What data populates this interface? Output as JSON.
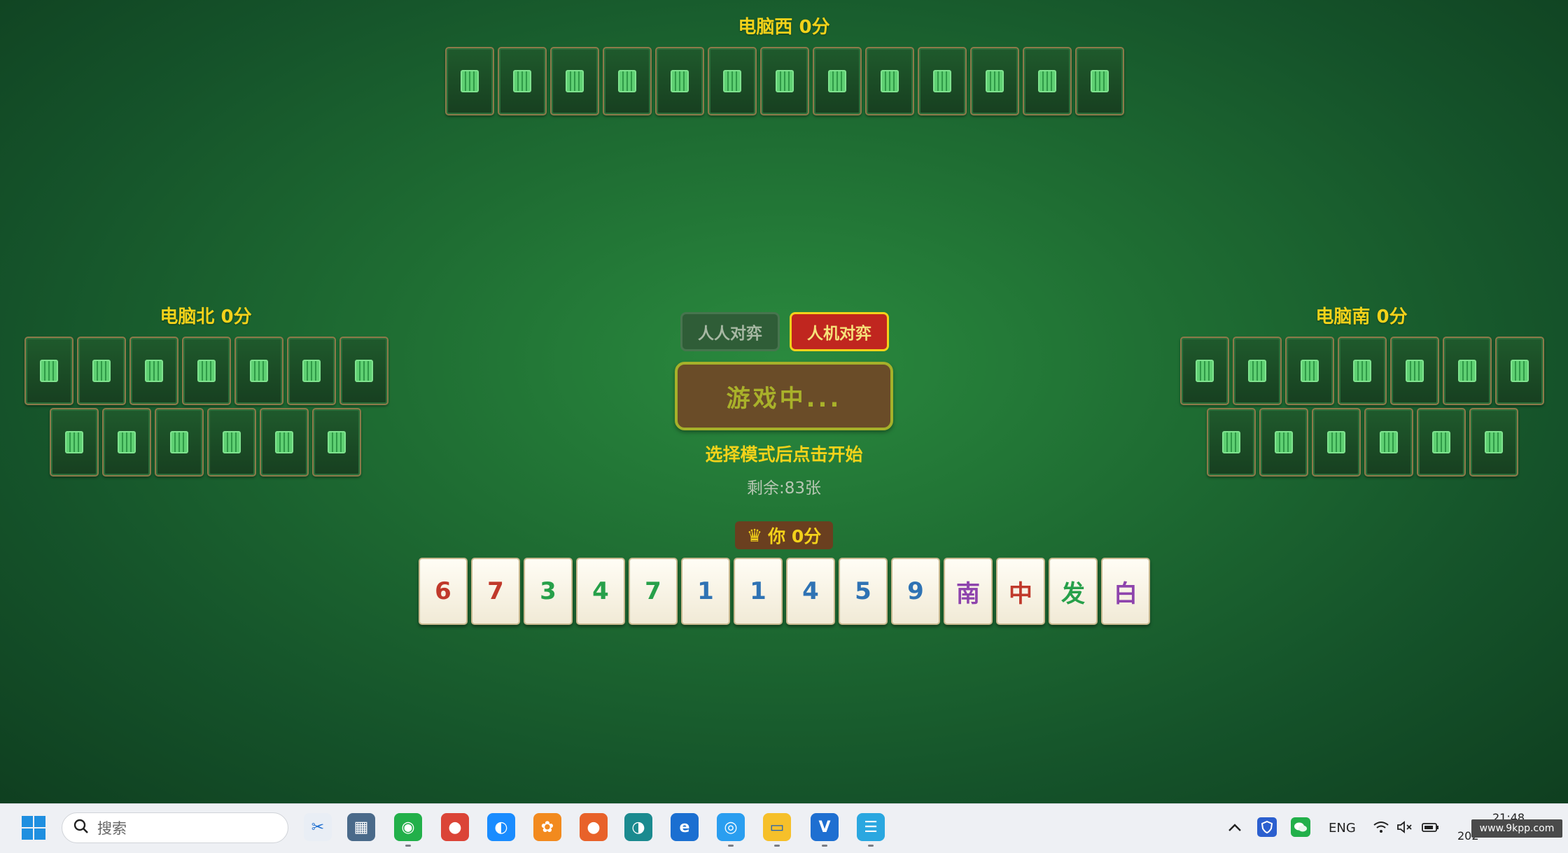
{
  "players": {
    "west": {
      "label": "电脑西 0分",
      "tile_count": 13
    },
    "north": {
      "label": "电脑北 0分",
      "tile_count": 13
    },
    "south": {
      "label": "电脑南 0分",
      "tile_count": 13
    }
  },
  "center": {
    "mode_pvp": "人人对弈",
    "mode_pve": "人机对弈",
    "selected_mode": "人机对弈",
    "start_label": "游戏中...",
    "hint": "选择模式后点击开始",
    "remaining": "剩余:83张"
  },
  "you": {
    "crown": "♛",
    "score_label": "你 0分",
    "hand": [
      {
        "face": "6",
        "color": "#c0392b"
      },
      {
        "face": "7",
        "color": "#c0392b"
      },
      {
        "face": "3",
        "color": "#27a04a"
      },
      {
        "face": "4",
        "color": "#27a04a"
      },
      {
        "face": "7",
        "color": "#27a04a"
      },
      {
        "face": "1",
        "color": "#2f73b4"
      },
      {
        "face": "1",
        "color": "#2f73b4"
      },
      {
        "face": "4",
        "color": "#2f73b4"
      },
      {
        "face": "5",
        "color": "#2f73b4"
      },
      {
        "face": "9",
        "color": "#2f73b4"
      },
      {
        "face": "南",
        "color": "#8e44ad"
      },
      {
        "face": "中",
        "color": "#c0392b"
      },
      {
        "face": "发",
        "color": "#27a04a"
      },
      {
        "face": "白",
        "color": "#8e44ad"
      }
    ]
  },
  "taskbar": {
    "search_placeholder": "搜索",
    "apps": [
      "snipping-tool-icon",
      "calculator-icon",
      "wechat-icon",
      "chrome-icon",
      "baidu-netdisk-icon",
      "app-orange-icon",
      "firefox-icon",
      "edge-icon",
      "ie-icon",
      "qq-browser-icon",
      "file-explorer-icon",
      "vscode-icon",
      "notepad-icon"
    ],
    "language": "ENG",
    "time": "21:48",
    "date": "202",
    "watermark": "www.9kpp.com"
  },
  "colors": {
    "accent_yellow": "#f3d21a",
    "felt": "#1f6e33"
  }
}
